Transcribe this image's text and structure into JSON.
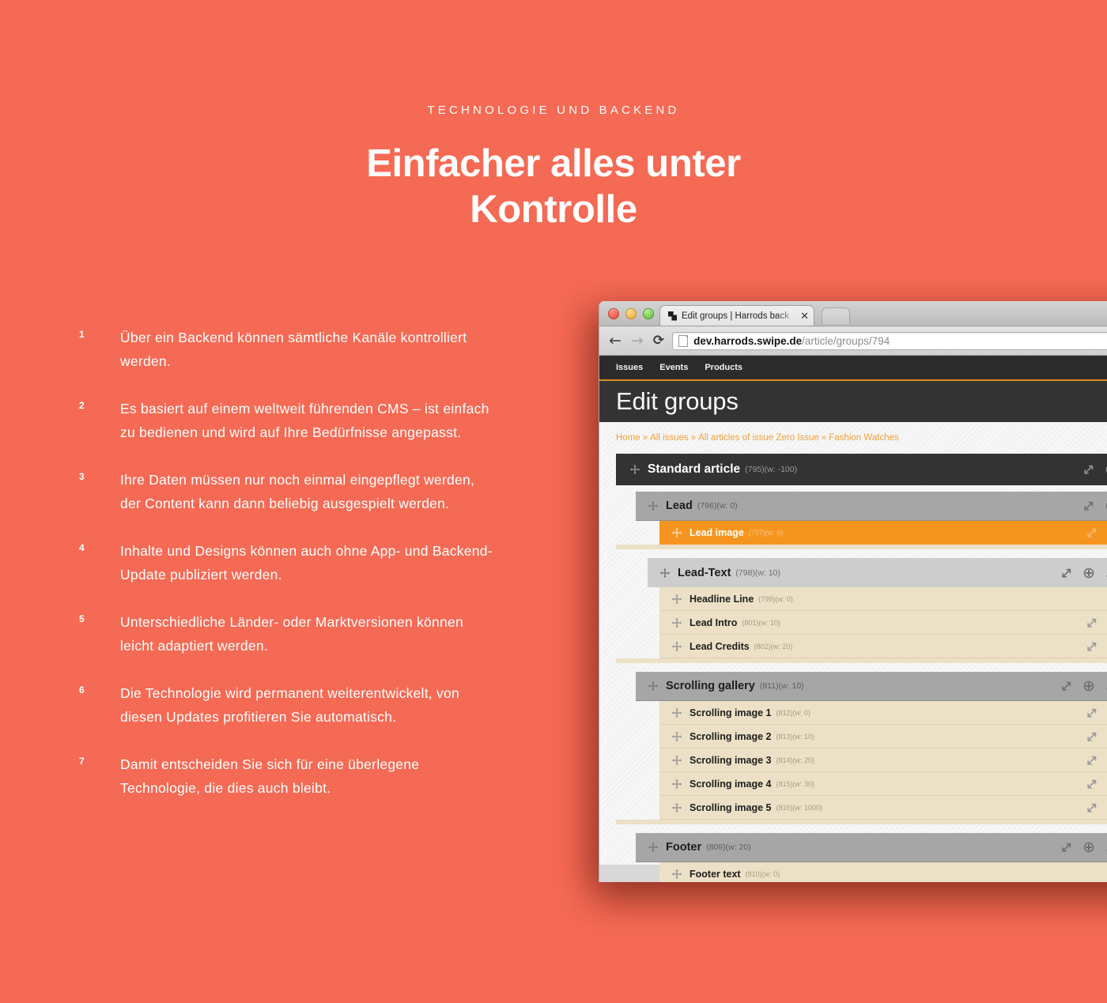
{
  "hero": {
    "eyebrow": "TECHNOLOGIE UND BACKEND",
    "headline_line1": "Einfacher alles unter",
    "headline_line2": "Kontrolle",
    "background_color": "#f56a54"
  },
  "features": [
    {
      "num": "1",
      "text": "Über ein Backend können sämtliche Kanäle kontrolliert werden."
    },
    {
      "num": "2",
      "text": "Es basiert auf einem weltweit führenden CMS – ist einfach zu bedienen und wird auf Ihre Bedürfnisse angepasst."
    },
    {
      "num": "3",
      "text": "Ihre Daten müssen nur noch einmal eingepflegt werden, der Content kann dann beliebig ausgespielt werden."
    },
    {
      "num": "4",
      "text": "Inhalte und Designs können auch ohne App- und Backend-Update publiziert werden."
    },
    {
      "num": "5",
      "text": "Unterschiedliche Länder- oder Marktversionen können leicht adaptiert werden."
    },
    {
      "num": "6",
      "text": "Die Technologie wird permanent weiterentwickelt, von diesen Updates profitieren Sie automatisch."
    },
    {
      "num": "7",
      "text": "Damit entscheiden Sie sich für eine überlegene Technologie, die dies auch bleibt."
    }
  ],
  "browser": {
    "tab": {
      "title": "Edit groups | Harrods back",
      "close_label": "✕"
    },
    "toolbar": {
      "back_label": "←",
      "forward_label": "→",
      "reload_label": "⟳",
      "url_host": "dev.harrods.swipe.de",
      "url_path": "/article/groups/794"
    },
    "appnav": [
      {
        "label": "Issues"
      },
      {
        "label": "Events"
      },
      {
        "label": "Products"
      }
    ],
    "page_title": "Edit groups",
    "breadcrumb": {
      "separator": "»",
      "items": [
        {
          "label": "Home"
        },
        {
          "label": "All issues"
        },
        {
          "label": "All articles of issue Zero Issue"
        },
        {
          "label": "Fashion Watches"
        }
      ]
    },
    "accent_orange": "#f0a13b",
    "selected_orange": "#f59520",
    "tree": [
      {
        "level": 0,
        "label": "Standard article",
        "meta": "(795)(w: -100)",
        "selected": false,
        "actions": [
          "resize",
          "plus",
          "wrench"
        ]
      },
      {
        "level": 1,
        "label": "Lead",
        "meta": "(796)(w: 0)",
        "selected": false,
        "actions": [
          "resize",
          "plus",
          "wrench"
        ]
      },
      {
        "level": 2,
        "label": "Lead image",
        "meta": "(797)(w: 0)",
        "selected": true,
        "actions": [
          "resize",
          "wrench",
          "trash"
        ]
      },
      {
        "level": 1,
        "label": "Lead-Text",
        "meta": "(798)(w: 10)",
        "selected": false,
        "actions": [
          "resize",
          "plus",
          "wrench",
          "trash"
        ]
      },
      {
        "level": 2,
        "label": "Headline Line",
        "meta": "(799)(w: 0)",
        "selected": false,
        "actions": [
          "resize",
          "wrench"
        ]
      },
      {
        "level": 2,
        "label": "Lead Intro",
        "meta": "(801)(w: 10)",
        "selected": false,
        "actions": [
          "resize",
          "wrench",
          "trash"
        ]
      },
      {
        "level": 2,
        "label": "Lead Credits",
        "meta": "(802)(w: 20)",
        "selected": false,
        "actions": [
          "resize",
          "wrench",
          "trash"
        ]
      },
      {
        "level": 1,
        "label": "Scrolling gallery",
        "meta": "(811)(w: 10)",
        "selected": false,
        "actions": [
          "resize",
          "plus",
          "wrench",
          "trash"
        ]
      },
      {
        "level": 2,
        "label": "Scrolling image 1",
        "meta": "(812)(w: 0)",
        "selected": false,
        "actions": [
          "resize",
          "wrench",
          "trash"
        ]
      },
      {
        "level": 2,
        "label": "Scrolling image 2",
        "meta": "(813)(w: 10)",
        "selected": false,
        "actions": [
          "resize",
          "wrench",
          "trash"
        ]
      },
      {
        "level": 2,
        "label": "Scrolling image 3",
        "meta": "(814)(w: 20)",
        "selected": false,
        "actions": [
          "resize",
          "wrench",
          "trash"
        ]
      },
      {
        "level": 2,
        "label": "Scrolling image 4",
        "meta": "(815)(w: 30)",
        "selected": false,
        "actions": [
          "resize",
          "wrench",
          "trash"
        ]
      },
      {
        "level": 2,
        "label": "Scrolling image 5",
        "meta": "(816)(w: 1000)",
        "selected": false,
        "actions": [
          "resize",
          "wrench",
          "trash"
        ]
      },
      {
        "level": 1,
        "label": "Footer",
        "meta": "(809)(w: 20)",
        "selected": false,
        "actions": [
          "resize",
          "plus",
          "wrench",
          "trash"
        ]
      },
      {
        "level": 2,
        "label": "Footer text",
        "meta": "(810)(w: 0)",
        "selected": false,
        "actions": [
          "resize",
          "wrench"
        ]
      }
    ]
  }
}
